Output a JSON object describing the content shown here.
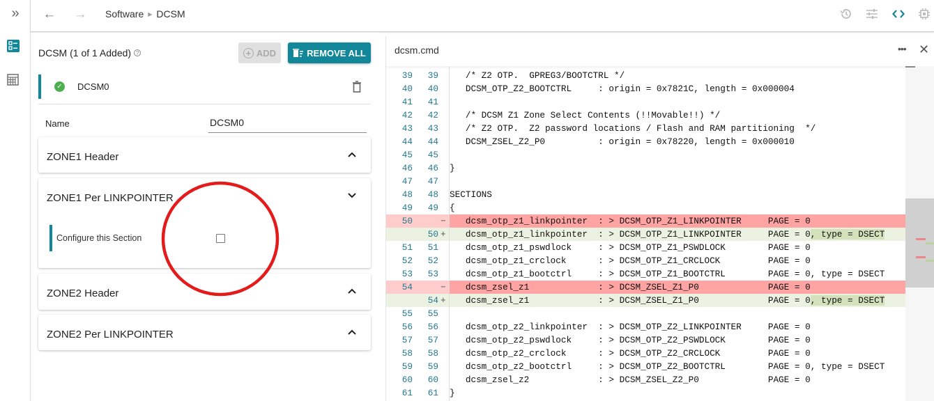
{
  "breadcrumb": {
    "items": [
      "Software",
      "DCSM"
    ]
  },
  "toolbar_icons": [
    "history-icon",
    "sliders-icon",
    "code-icon",
    "chip-icon"
  ],
  "accent": "#13879a",
  "panel": {
    "title": "DCSM (1 of 1 Added)",
    "add_label": "ADD",
    "remove_all_label": "REMOVE ALL",
    "instance": {
      "name": "DCSM0",
      "status": "valid"
    },
    "name_label": "Name",
    "name_value": "DCSM0",
    "sections": [
      {
        "title": "ZONE1 Header",
        "expanded": false
      },
      {
        "title": "ZONE1 Per LINKPOINTER",
        "expanded": true,
        "field_label": "Configure this Section",
        "checked": false
      },
      {
        "title": "ZONE2 Header",
        "expanded": false
      },
      {
        "title": "ZONE2 Per LINKPOINTER",
        "expanded": false
      }
    ]
  },
  "editor": {
    "filename": "dcsm.cmd",
    "lines": [
      {
        "o": "39",
        "n": "39",
        "t": "   /* Z2 OTP.  GPREG3/BOOTCTRL */"
      },
      {
        "o": "40",
        "n": "40",
        "t": "   DCSM_OTP_Z2_BOOTCTRL     : origin = 0x7821C, length = 0x000004"
      },
      {
        "o": "41",
        "n": "41",
        "t": ""
      },
      {
        "o": "42",
        "n": "42",
        "t": "   /* DCSM Z1 Zone Select Contents (!!Movable!!) */"
      },
      {
        "o": "43",
        "n": "43",
        "t": "   /* Z2 OTP.  Z2 password locations / Flash and RAM partitioning  */"
      },
      {
        "o": "44",
        "n": "44",
        "t": "   DCSM_ZSEL_Z2_P0          : origin = 0x78220, length = 0x000010"
      },
      {
        "o": "45",
        "n": "45",
        "t": ""
      },
      {
        "o": "46",
        "n": "46",
        "t": "}"
      },
      {
        "o": "47",
        "n": "47",
        "t": ""
      },
      {
        "o": "48",
        "n": "48",
        "t": "SECTIONS"
      },
      {
        "o": "49",
        "n": "49",
        "t": "{"
      },
      {
        "o": "50",
        "n": "",
        "k": "del",
        "t": "   dcsm_otp_z1_linkpointer  : > DCSM_OTP_Z1_LINKPOINTER     PAGE = 0"
      },
      {
        "o": "",
        "n": "50",
        "k": "add",
        "t": "   dcsm_otp_z1_linkpointer  : > DCSM_OTP_Z1_LINKPOINTER     PAGE = 0",
        "h": ", type = DSECT"
      },
      {
        "o": "51",
        "n": "51",
        "t": "   dcsm_otp_z1_pswdlock     : > DCSM_OTP_Z1_PSWDLOCK        PAGE = 0"
      },
      {
        "o": "52",
        "n": "52",
        "t": "   dcsm_otp_z1_crclock      : > DCSM_OTP_Z1_CRCLOCK         PAGE = 0"
      },
      {
        "o": "53",
        "n": "53",
        "t": "   dcsm_otp_z1_bootctrl     : > DCSM_OTP_Z1_BOOTCTRL        PAGE = 0, type = DSECT"
      },
      {
        "o": "54",
        "n": "",
        "k": "del",
        "t": "   dcsm_zsel_z1             : > DCSM_ZSEL_Z1_P0             PAGE = 0"
      },
      {
        "o": "",
        "n": "54",
        "k": "add",
        "t": "   dcsm_zsel_z1             : > DCSM_ZSEL_Z1_P0             PAGE = 0",
        "h": ", type = DSECT"
      },
      {
        "o": "55",
        "n": "55",
        "t": ""
      },
      {
        "o": "56",
        "n": "56",
        "t": "   dcsm_otp_z2_linkpointer  : > DCSM_OTP_Z2_LINKPOINTER     PAGE = 0"
      },
      {
        "o": "57",
        "n": "57",
        "t": "   dcsm_otp_z2_pswdlock     : > DCSM_OTP_Z2_PSWDLOCK        PAGE = 0"
      },
      {
        "o": "58",
        "n": "58",
        "t": "   dcsm_otp_z2_crclock      : > DCSM_OTP_Z2_CRCLOCK         PAGE = 0"
      },
      {
        "o": "59",
        "n": "59",
        "t": "   dcsm_otp_z2_bootctrl     : > DCSM_OTP_Z2_BOOTCTRL        PAGE = 0, type = DSECT"
      },
      {
        "o": "60",
        "n": "60",
        "t": "   dcsm_zsel_z2             : > DCSM_ZSEL_Z2_P0             PAGE = 0"
      },
      {
        "o": "61",
        "n": "61",
        "t": "}"
      }
    ]
  }
}
